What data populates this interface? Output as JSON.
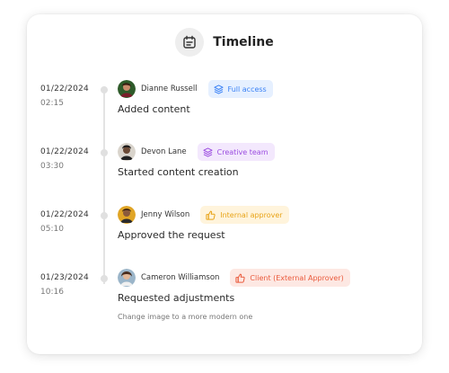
{
  "header": {
    "title": "Timeline",
    "icon": "calendar-icon"
  },
  "entries": [
    {
      "date": "01/22/2024",
      "time": "02:15",
      "user": "Dianne Russell",
      "badge": {
        "label": "Full access",
        "icon": "layers-icon",
        "color": "#3b82f6",
        "bg": "#e6f0ff"
      },
      "action": "Added content",
      "note": ""
    },
    {
      "date": "01/22/2024",
      "time": "03:30",
      "user": "Devon Lane",
      "badge": {
        "label": "Creative team",
        "icon": "layers-icon",
        "color": "#9b4de0",
        "bg": "#f3e8fd"
      },
      "action": "Started content creation",
      "note": ""
    },
    {
      "date": "01/22/2024",
      "time": "05:10",
      "user": "Jenny Wilson",
      "badge": {
        "label": "Internal approver",
        "icon": "thumbs-up-icon",
        "color": "#e8a317",
        "bg": "#fff4dc"
      },
      "action": "Approved the request",
      "note": ""
    },
    {
      "date": "01/23/2024",
      "time": "10:16",
      "user": "Cameron Williamson",
      "badge": {
        "label": "Client (External Approver)",
        "icon": "thumbs-up-icon",
        "color": "#ea5a3c",
        "bg": "#fde8e3"
      },
      "action": "Requested adjustments",
      "note": "Change image to a more modern one"
    }
  ]
}
